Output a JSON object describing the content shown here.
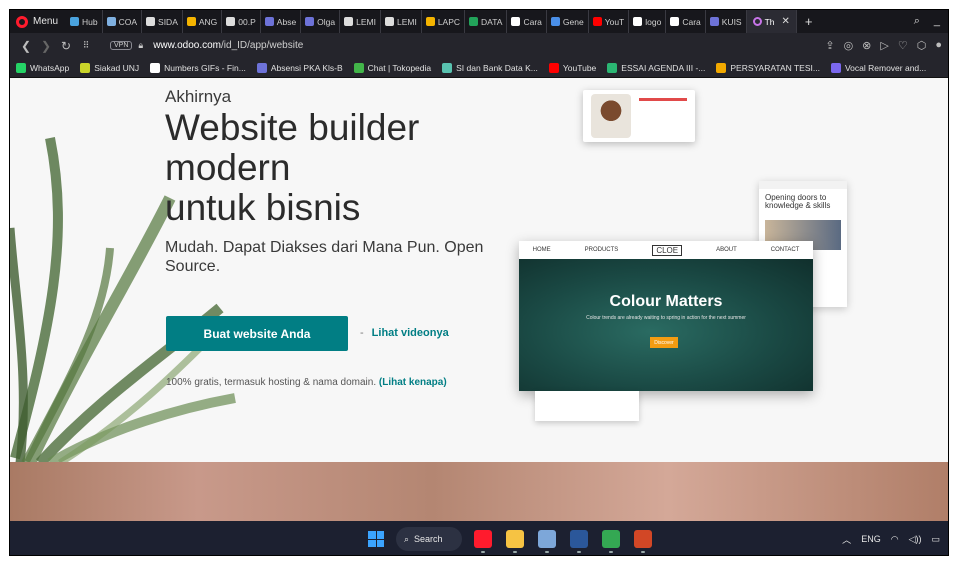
{
  "browser": {
    "menu_label": "Menu",
    "tabs": [
      {
        "label": "Hub",
        "color": "#4aa3df"
      },
      {
        "label": "COA",
        "color": "#7fb0e0"
      },
      {
        "label": "SIDA",
        "color": "#dddddd"
      },
      {
        "label": "ANG",
        "color": "#f5b400"
      },
      {
        "label": "00.P",
        "color": "#dddddd"
      },
      {
        "label": "Abse",
        "color": "#6d72d8"
      },
      {
        "label": "Olga",
        "color": "#6d72d8"
      },
      {
        "label": "LEMI",
        "color": "#dddddd"
      },
      {
        "label": "LEMI",
        "color": "#dddddd"
      },
      {
        "label": "LAPC",
        "color": "#f5b400"
      },
      {
        "label": "DATA",
        "color": "#22a35a"
      },
      {
        "label": "Cara",
        "color": "#ffffff"
      },
      {
        "label": "Gene",
        "color": "#4a8fe8"
      },
      {
        "label": "YouT",
        "color": "#ff0000"
      },
      {
        "label": "logo",
        "color": "#ffffff"
      },
      {
        "label": "Cara",
        "color": "#ffffff"
      },
      {
        "label": "KUIS",
        "color": "#6d72d8"
      }
    ],
    "active_tab": {
      "label": "Th",
      "color": "#c774e8"
    },
    "url_host": "www.odoo.com",
    "url_path": "/id_ID/app/website",
    "vpn_label": "VPN"
  },
  "bookmarks": [
    {
      "label": "WhatsApp",
      "color": "#25d366"
    },
    {
      "label": "Siakad UNJ",
      "color": "#c9d42a"
    },
    {
      "label": "Numbers GIFs - Fin...",
      "color": "#ffffff"
    },
    {
      "label": "Absensi PKA Kls-B",
      "color": "#6d72d8"
    },
    {
      "label": "Chat | Tokopedia",
      "color": "#42b549"
    },
    {
      "label": "SI dan Bank Data K...",
      "color": "#59c2b0"
    },
    {
      "label": "YouTube",
      "color": "#ff0000"
    },
    {
      "label": "ESSAI AGENDA III -...",
      "color": "#2bb673"
    },
    {
      "label": "PERSYARATAN TESI...",
      "color": "#f2a900"
    },
    {
      "label": "Vocal Remover and...",
      "color": "#7b68ee"
    }
  ],
  "hero": {
    "pre_title": "Akhirnya",
    "title_lines": [
      "Website builder",
      "modern",
      "untuk bisnis"
    ],
    "subtitle": "Mudah. Dapat Diakses dari Mana Pun. Open Source.",
    "cta_label": "Buat website Anda",
    "video_dash": "-",
    "video_link": "Lihat videonya",
    "note_text": "100% gratis, termasuk hosting & nama domain.",
    "note_link": "(Lihat kenapa)",
    "accent_color": "#017e84"
  },
  "mockups": {
    "doors_heading": "Opening doors to knowledge & skills",
    "main_logo": "CLOE",
    "main_title": "Colour Matters",
    "main_subtitle": "Colour trends are already waiting to spring in action for the next summer",
    "main_button": "Discover",
    "nav_items": [
      "HOME",
      "PRODUCTS",
      "ABOUT",
      "CONTACT"
    ]
  },
  "taskbar": {
    "search_label": "Search",
    "language": "ENG",
    "apps": [
      {
        "name": "opera-icon",
        "color": "#ff1b2d"
      },
      {
        "name": "file-explorer-icon",
        "color": "#f6c343"
      },
      {
        "name": "app-icon",
        "color": "#7da7d9"
      },
      {
        "name": "word-icon",
        "color": "#2b579a"
      },
      {
        "name": "edge-icon",
        "color": "#34a853"
      },
      {
        "name": "powerpoint-icon",
        "color": "#d24726"
      }
    ]
  }
}
